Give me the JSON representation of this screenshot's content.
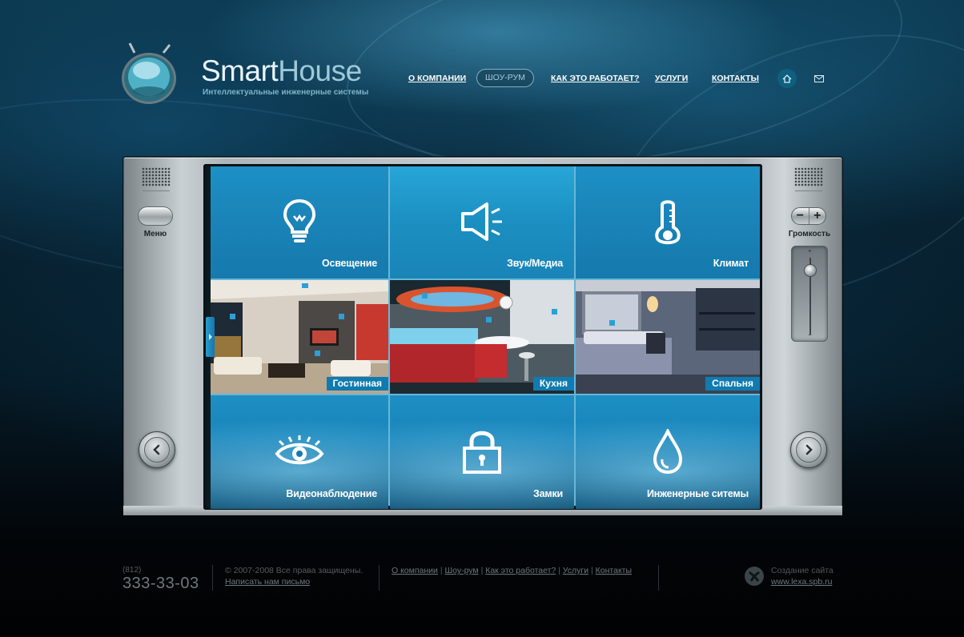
{
  "brand": {
    "name_part1": "Smart",
    "name_part2": "House",
    "tagline": "Интеллектуальные инженерные системы"
  },
  "nav": {
    "items": [
      "О КОМПАНИИ",
      "КАК ЭТО РАБОТАЕТ?",
      "УСЛУГИ",
      "КОНТАКТЫ"
    ],
    "active": "ШОУ-РУМ",
    "icons": [
      "home-icon",
      "mail-icon"
    ]
  },
  "device": {
    "menu_label": "Меню",
    "volume_label": "Громкость",
    "volume_minus": "−",
    "volume_plus": "+",
    "volume_level": 0.9,
    "arrows": [
      "chevron-left-icon",
      "chevron-right-icon"
    ]
  },
  "tiles": {
    "lighting": "Освещение",
    "sound": "Звук/Медиа",
    "climate": "Климат",
    "living_room": "Гостинная",
    "kitchen": "Кухня",
    "bedroom": "Спальня",
    "video": "Видеонаблюдение",
    "locks": "Замки",
    "engineering": "Инженерные ситемы"
  },
  "colors": {
    "tile_blue": "#1b8cc1",
    "tile_label_bg": "#0f7bb0",
    "nav_text": "#ffffff",
    "footer_text": "#545d62"
  },
  "footer": {
    "phone_code": "(812)",
    "phone": "333-33-03",
    "copyright": "© 2007-2008 Все права защищены.",
    "write_us": "Написать нам письмо",
    "links": [
      "О компании",
      "Шоу-рум",
      "Как это работает?",
      "Услуги",
      "Контакты"
    ],
    "separator": " | ",
    "made_by_label": "Создание сайта",
    "made_by_site": "www.lexa.spb.ru"
  }
}
